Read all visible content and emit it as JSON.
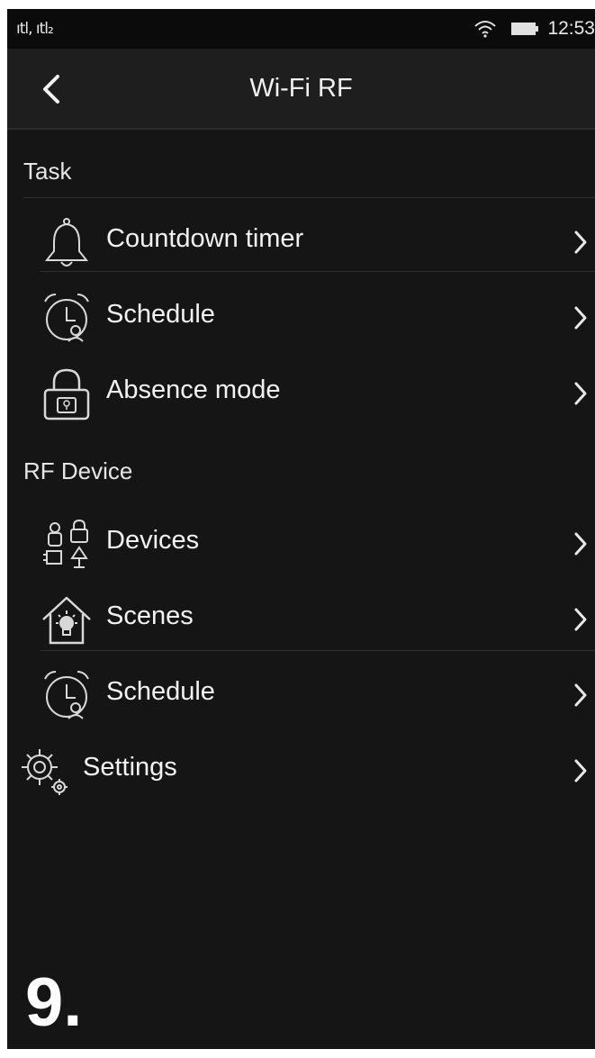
{
  "status_bar": {
    "signal": "ıtl, ıtl₂",
    "time": "12:53",
    "icons": [
      "signal-icon",
      "wifi-icon",
      "battery-icon"
    ]
  },
  "header": {
    "title": "Wi-Fi RF",
    "back_icon": "back-chevron-icon"
  },
  "sections": {
    "task": {
      "label": "Task",
      "items": [
        {
          "label": "Countdown timer",
          "icon": "bell-icon"
        },
        {
          "label": "Schedule",
          "icon": "alarm-clock-icon"
        },
        {
          "label": "Absence mode",
          "icon": "padlock-icon"
        }
      ]
    },
    "rf_device": {
      "label": "RF Device",
      "items": [
        {
          "label": "Devices",
          "icon": "devices-icon"
        },
        {
          "label": "Scenes",
          "icon": "house-bulb-icon"
        },
        {
          "label": "Schedule",
          "icon": "alarm-clock-icon"
        }
      ]
    }
  },
  "settings": {
    "label": "Settings",
    "icon": "gear-icon"
  },
  "page_number": "9.",
  "colors": {
    "background": "#151515",
    "appbar": "#1e1e1e",
    "text": "#f2f2f2",
    "divider": "#2e2e2e"
  }
}
